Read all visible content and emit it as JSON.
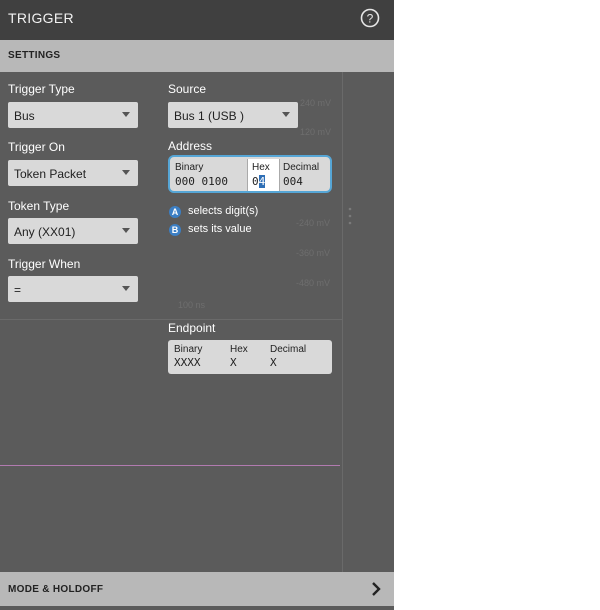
{
  "title": "TRIGGER",
  "section": "SETTINGS",
  "trigger_type": {
    "label": "Trigger Type",
    "value": "Bus"
  },
  "source": {
    "label": "Source",
    "value": "Bus 1 (USB )"
  },
  "trigger_on": {
    "label": "Trigger On",
    "value": "Token Packet"
  },
  "address": {
    "label": "Address",
    "binary_caption": "Binary",
    "binary_value": "000 0100",
    "hex_caption": "Hex",
    "hex_value_prefix": "0",
    "hex_value_cursor": "4",
    "decimal_caption": "Decimal",
    "decimal_value": "004"
  },
  "token_type": {
    "label": "Token Type",
    "value": "Any (XX01)"
  },
  "hints": [
    {
      "badge": "A",
      "text": "selects digit(s)"
    },
    {
      "badge": "B",
      "text": "sets its value"
    }
  ],
  "trigger_when": {
    "label": "Trigger When",
    "value": "="
  },
  "endpoint": {
    "label": "Endpoint",
    "binary_caption": "Binary",
    "binary_value": "XXXX",
    "hex_caption": "Hex",
    "hex_value": "X",
    "decimal_caption": "Decimal",
    "decimal_value": "X"
  },
  "background_scale": [
    "240 mV",
    "120 mV",
    "-240 mV",
    "-360 mV",
    "-480 mV",
    "100 ns"
  ],
  "mode_holdoff": "MODE & HOLDOFF",
  "colors": {
    "accent": "#56a6d6",
    "badge": "#3c7fc4",
    "trace": "#b27bb0"
  }
}
